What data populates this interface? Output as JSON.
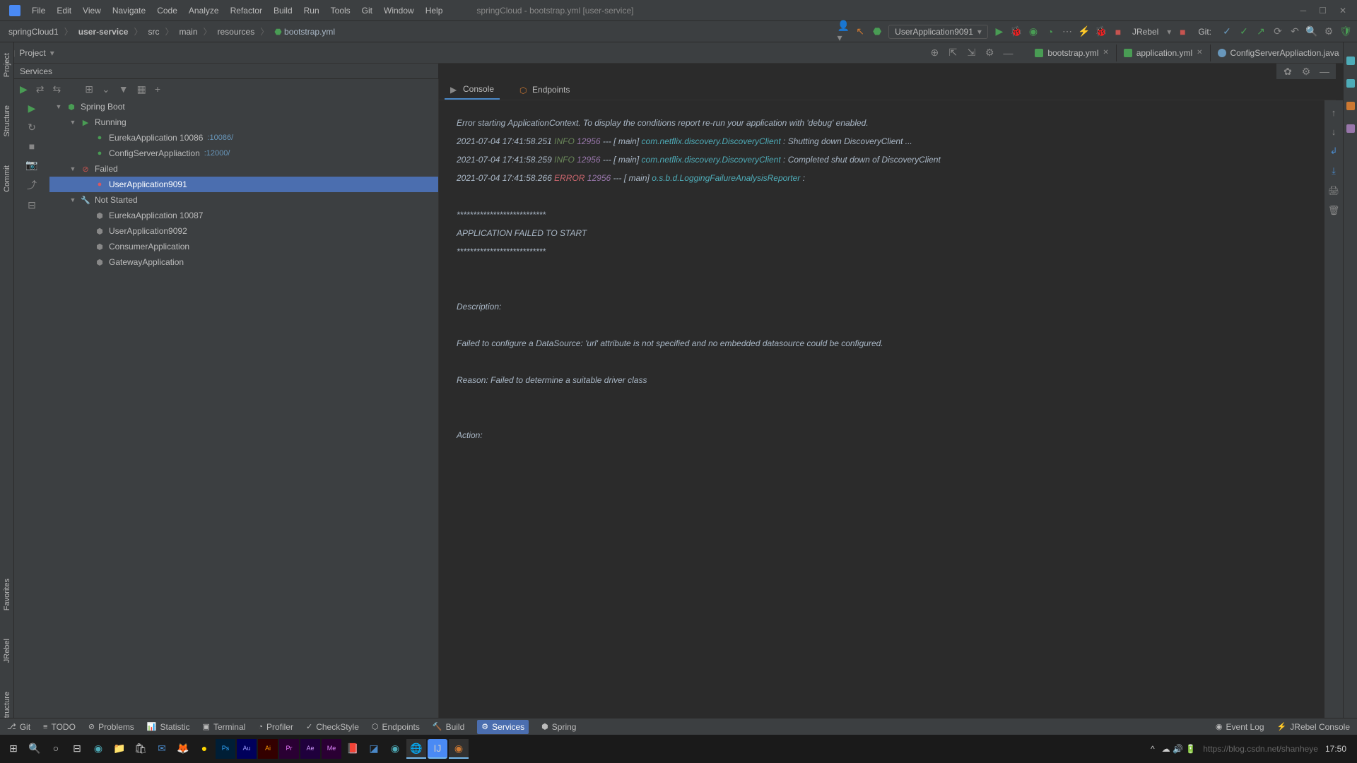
{
  "titlebar": {
    "menus": [
      "File",
      "Edit",
      "View",
      "Navigate",
      "Code",
      "Analyze",
      "Refactor",
      "Build",
      "Run",
      "Tools",
      "Git",
      "Window",
      "Help"
    ],
    "title": "springCloud - bootstrap.yml [user-service]"
  },
  "breadcrumb": [
    "springCloud1",
    "user-service",
    "src",
    "main",
    "resources",
    "bootstrap.yml"
  ],
  "run_config": "UserApplication9091",
  "navbar_right": {
    "git": "Git:",
    "jrebel": "JRebel"
  },
  "project_dropdown": "Project",
  "editor_tabs": [
    {
      "name": "bootstrap.yml",
      "icon": "green"
    },
    {
      "name": "application.yml",
      "icon": "green"
    },
    {
      "name": "ConfigServerAppliaction.java",
      "icon": "blue"
    }
  ],
  "services_label": "Services",
  "tree": {
    "root": "Spring Boot",
    "groups": [
      {
        "name": "Running",
        "items": [
          {
            "name": "EurekaApplication 10086",
            "port": ":10086/"
          },
          {
            "name": "ConfigServerAppliaction",
            "port": ":12000/"
          }
        ]
      },
      {
        "name": "Failed",
        "items": [
          {
            "name": "UserApplication9091",
            "selected": true
          }
        ]
      },
      {
        "name": "Not Started",
        "items": [
          {
            "name": "EurekaApplication 10087"
          },
          {
            "name": "UserApplication9092"
          },
          {
            "name": "ConsumerApplication"
          },
          {
            "name": "GatewayApplication"
          }
        ]
      }
    ]
  },
  "content_tabs": {
    "console": "Console",
    "endpoints": "Endpoints"
  },
  "console": {
    "l1": "Error starting ApplicationContext. To display the conditions report re-run your application with 'debug' enabled.",
    "l2a": "2021-07-04 17:41:58.251  ",
    "l2b": "INFO",
    "l2c": " 12956",
    "l2d": " --- [           main] ",
    "l2e": "com.netflix.discovery.DiscoveryClient",
    "l2f": "    : Shutting down DiscoveryClient ...",
    "l3a": "2021-07-04 17:41:58.259  ",
    "l3b": "INFO",
    "l3c": " 12956",
    "l3d": " --- [           main] ",
    "l3e": "com.netflix.discovery.DiscoveryClient",
    "l3f": "    : Completed shut down of DiscoveryClient",
    "l4a": "2021-07-04 17:41:58.266 ",
    "l4b": "ERROR",
    "l4c": " 12956",
    "l4d": " --- [           main] ",
    "l4e": "o.s.b.d.LoggingFailureAnalysisReporter",
    "l4f": "   :",
    "l5": "***************************",
    "l6": "APPLICATION FAILED TO START",
    "l7": "***************************",
    "l8": "Description:",
    "l9": "Failed to configure a DataSource: 'url' attribute is not specified and no embedded datasource could be configured.",
    "l10": "Reason: Failed to determine a suitable driver class",
    "l11": "Action:"
  },
  "footer": {
    "items": [
      "Git",
      "TODO",
      "Problems",
      "Statistic",
      "Terminal",
      "Profiler",
      "CheckStyle",
      "Endpoints",
      "Build",
      "Services",
      "Spring"
    ],
    "active": "Services",
    "right": [
      "Event Log",
      "JRebel Console"
    ]
  },
  "left_edge": [
    "Project",
    "Structure",
    "Commit",
    "Favorites",
    "JRebel",
    "JPA Structure"
  ],
  "taskbar": {
    "time": "17:50",
    "watermark": "https://blog.csdn.net/shanheye"
  }
}
